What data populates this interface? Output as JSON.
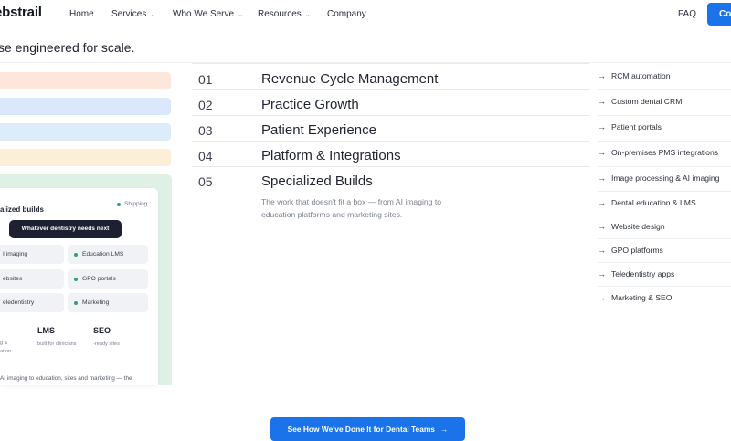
{
  "brand": {
    "logo_text": "ebstrail"
  },
  "nav": {
    "items": [
      "Home",
      "Services",
      "Who We Serve",
      "Resources",
      "Company"
    ],
    "faq": "FAQ",
    "cta": "Co"
  },
  "tagline": "se engineered for scale.",
  "illustration": {
    "band_colors": [
      "#fde7dc",
      "#dbe8fb",
      "#dcecf8",
      "#fcefd8"
    ],
    "panel_color": "#dff1e4",
    "card": {
      "title": "alized builds",
      "status": "Shipping",
      "pill": "Whatever dentistry needs next",
      "chips": [
        "I imaging",
        "Education LMS",
        "ebsites",
        "GPO portals",
        "eledentistry",
        "Marketing"
      ],
      "stats": [
        {
          "value": "",
          "sub_lines": [
            "g &",
            "ation"
          ]
        },
        {
          "value": "LMS",
          "sub_lines": [
            "built for clinicians"
          ]
        },
        {
          "value": "SEO",
          "sub_lines": [
            "-ready sites"
          ]
        }
      ],
      "footer": "AI imaging to education, sites and marketing — the"
    }
  },
  "services": [
    {
      "num": "01",
      "name": "Revenue Cycle Management"
    },
    {
      "num": "02",
      "name": "Practice Growth"
    },
    {
      "num": "03",
      "name": "Patient Experience"
    },
    {
      "num": "04",
      "name": "Platform & Integrations"
    },
    {
      "num": "05",
      "name": "Specialized Builds"
    }
  ],
  "service_description": "The work that doesn't fit a box — from AI imaging to education platforms and marketing sites.",
  "right_list": [
    "RCM automation",
    "Custom dental CRM",
    "Patient portals",
    "On-premises PMS integrations",
    "Image processing & AI imaging",
    "Dental education & LMS",
    "Website design",
    "GPO platforms",
    "Teledentistry apps",
    "Marketing & SEO"
  ],
  "cta_button": "See How We've Done It for Dental Teams",
  "colors": {
    "accent": "#1a73e8",
    "dark": "#1b2130",
    "status_green": "#2fa36b"
  }
}
